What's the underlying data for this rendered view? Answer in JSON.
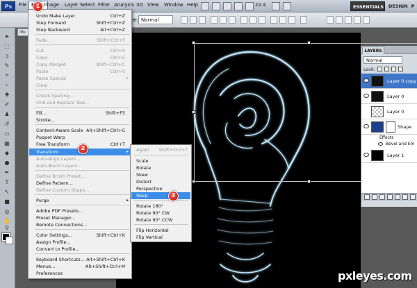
{
  "menubar": {
    "logo": "Ps",
    "items": [
      "File",
      "Edit",
      "Image",
      "Layer",
      "Select",
      "Filter",
      "Analysis",
      "3D",
      "View",
      "Window",
      "Help"
    ],
    "zoom": "22.4"
  },
  "workspace": {
    "essentials": "ESSENTIALS",
    "design": "DESIGN",
    "more": "P"
  },
  "options_bar": {
    "mode_label": "de:",
    "mode_value": "Normal"
  },
  "document_tab": {
    "title": "illu"
  },
  "edit_menu": {
    "items": [
      {
        "label": "Undo Make Layer",
        "shortcut": "Ctrl+Z",
        "disabled": false
      },
      {
        "label": "Step Forward",
        "shortcut": "Shift+Ctrl+Z",
        "disabled": false
      },
      {
        "label": "Step Backward",
        "shortcut": "Alt+Ctrl+Z",
        "disabled": false
      },
      {
        "label": "Fade...",
        "shortcut": "Shift+Ctrl+F",
        "disabled": true
      },
      {
        "label": "Cut",
        "shortcut": "Ctrl+X",
        "disabled": true
      },
      {
        "label": "Copy",
        "shortcut": "Ctrl+C",
        "disabled": true
      },
      {
        "label": "Copy Merged",
        "shortcut": "Shift+Ctrl+C",
        "disabled": true
      },
      {
        "label": "Paste",
        "shortcut": "Ctrl+V",
        "disabled": true
      },
      {
        "label": "Paste Special",
        "shortcut": "",
        "disabled": true
      },
      {
        "label": "Clear",
        "shortcut": "",
        "disabled": true
      },
      {
        "label": "Check Spelling...",
        "shortcut": "",
        "disabled": true
      },
      {
        "label": "Find and Replace Text...",
        "shortcut": "",
        "disabled": true
      },
      {
        "label": "Fill...",
        "shortcut": "Shift+F5",
        "disabled": false
      },
      {
        "label": "Stroke...",
        "shortcut": "",
        "disabled": false
      },
      {
        "label": "Content-Aware Scale",
        "shortcut": "Alt+Shift+Ctrl+C",
        "disabled": false
      },
      {
        "label": "Puppet Warp",
        "shortcut": "",
        "disabled": false
      },
      {
        "label": "Free Transform",
        "shortcut": "Ctrl+T",
        "disabled": false
      },
      {
        "label": "Transform",
        "shortcut": "",
        "disabled": false
      },
      {
        "label": "Auto-Align Layers...",
        "shortcut": "",
        "disabled": true
      },
      {
        "label": "Auto-Blend Layers...",
        "shortcut": "",
        "disabled": true
      },
      {
        "label": "Define Brush Preset...",
        "shortcut": "",
        "disabled": true
      },
      {
        "label": "Define Pattern...",
        "shortcut": "",
        "disabled": false
      },
      {
        "label": "Define Custom Shape...",
        "shortcut": "",
        "disabled": true
      },
      {
        "label": "Purge",
        "shortcut": "",
        "disabled": false
      },
      {
        "label": "Adobe PDF Presets...",
        "shortcut": "",
        "disabled": false
      },
      {
        "label": "Preset Manager...",
        "shortcut": "",
        "disabled": false
      },
      {
        "label": "Remote Connections...",
        "shortcut": "",
        "disabled": false
      },
      {
        "label": "Color Settings...",
        "shortcut": "Shift+Ctrl+K",
        "disabled": false
      },
      {
        "label": "Assign Profile...",
        "shortcut": "",
        "disabled": false
      },
      {
        "label": "Convert to Profile...",
        "shortcut": "",
        "disabled": false
      },
      {
        "label": "Keyboard Shortcuts...",
        "shortcut": "Alt+Shift+Ctrl+K",
        "disabled": false
      },
      {
        "label": "Menus...",
        "shortcut": "Alt+Shift+Ctrl+M",
        "disabled": false
      },
      {
        "label": "Preferences",
        "shortcut": "",
        "disabled": false
      }
    ]
  },
  "transform_submenu": {
    "items": [
      {
        "label": "Again",
        "shortcut": "Shift+Ctrl+T",
        "disabled": true
      },
      {
        "label": "Scale",
        "shortcut": "",
        "disabled": false
      },
      {
        "label": "Rotate",
        "shortcut": "",
        "disabled": false
      },
      {
        "label": "Skew",
        "shortcut": "",
        "disabled": false
      },
      {
        "label": "Distort",
        "shortcut": "",
        "disabled": false
      },
      {
        "label": "Perspective",
        "shortcut": "",
        "disabled": false
      },
      {
        "label": "Warp",
        "shortcut": "",
        "disabled": false
      },
      {
        "label": "Rotate 180°",
        "shortcut": "",
        "disabled": false
      },
      {
        "label": "Rotate 90° CW",
        "shortcut": "",
        "disabled": false
      },
      {
        "label": "Rotate 90° CCW",
        "shortcut": "",
        "disabled": false
      },
      {
        "label": "Flip Horizontal",
        "shortcut": "",
        "disabled": false
      },
      {
        "label": "Flip Vertical",
        "shortcut": "",
        "disabled": false
      }
    ]
  },
  "steps": [
    "1",
    "2",
    "3"
  ],
  "layers_panel": {
    "tab": "LAYERS",
    "blend_mode": "Normal",
    "lock_label": "Lock:",
    "layers": [
      {
        "name": "Layer 0 copy",
        "selected": true
      },
      {
        "name": "Layer 0",
        "selected": false
      },
      {
        "name": "Layer 0",
        "selected": false
      },
      {
        "name": "Shape",
        "selected": false
      },
      {
        "name": "Layer 1",
        "selected": false
      }
    ],
    "effects_label": "Effects",
    "effect_name": "Bevel and Em"
  },
  "watermark": "pxleyes.com",
  "colors": {
    "menu_highlight": "#3b8ee8",
    "badge_red": "#d0201a",
    "layer_selected": "#3f76c8"
  }
}
